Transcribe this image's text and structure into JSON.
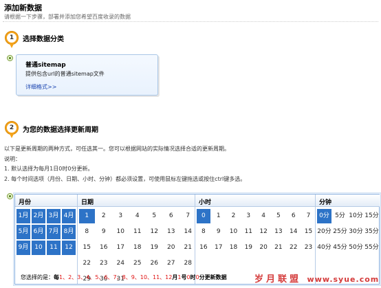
{
  "page": {
    "title": "添加新数据",
    "subtitle": "请根据一下步骤，部署并添加您希望百度收录的数据"
  },
  "step1": {
    "number": "1",
    "title": "选择数据分类",
    "card": {
      "title": "普通sitemap",
      "description": "提供包含url的普通sitemap文件",
      "link": "详细格式>>"
    }
  },
  "step2": {
    "number": "2",
    "title": "为您的数据选择更新周期",
    "lines": [
      "以下是更新周期的两种方式，可任选其一。您可以根据网站的实际情况选择合适的更新周期。",
      "说明：",
      "1. 默认选择为每月1日0时0分更新。",
      "2. 每个时间选项（月份、日期、小时、分钟）都必须设置，可使用鼠标左键拖选或按住ctrl键多选。"
    ]
  },
  "scheduler": {
    "month_header": "月份",
    "day_header": "日期",
    "hour_header": "小时",
    "minute_header": "分钟",
    "months": [
      "1月",
      "2月",
      "3月",
      "4月",
      "5月",
      "6月",
      "7月",
      "8月",
      "9月",
      "10月",
      "11月",
      "12月"
    ],
    "months_selected": "all",
    "days": [
      "1",
      "2",
      "3",
      "4",
      "5",
      "6",
      "7",
      "8",
      "9",
      "10",
      "11",
      "12",
      "13",
      "14",
      "15",
      "16",
      "17",
      "18",
      "19",
      "20",
      "21",
      "22",
      "23",
      "24",
      "25",
      "26",
      "27",
      "28",
      "29",
      "30",
      "31"
    ],
    "day_selected": "1",
    "hours": [
      "0",
      "1",
      "2",
      "3",
      "4",
      "5",
      "6",
      "7",
      "8",
      "9",
      "10",
      "11",
      "12",
      "13",
      "14",
      "15",
      "16",
      "17",
      "18",
      "19",
      "20",
      "21",
      "22",
      "23"
    ],
    "hour_selected": "0",
    "minutes": [
      "0分",
      "5分",
      "10分",
      "15分",
      "20分",
      "25分",
      "30分",
      "35分",
      "40分",
      "45分",
      "50分",
      "55分"
    ],
    "minute_selected": "0分",
    "footer": {
      "label": "您选择的是：",
      "prefix": "每",
      "months_text": "1、2、3、4、5、6、7、8、9、10、11、12",
      "unit_month": "月",
      "day_text": "1",
      "unit_day": "号",
      "hour_text": "0",
      "unit_hour": "时",
      "minute_text": "0",
      "suffix": "分更新数据"
    }
  },
  "watermark": {
    "text": "岁月联盟",
    "url": "www.syue.com"
  }
}
